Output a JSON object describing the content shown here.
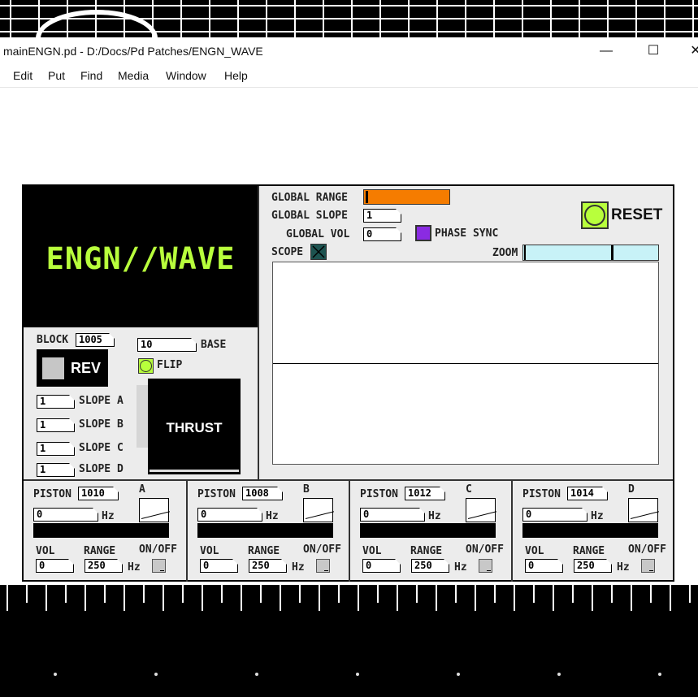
{
  "window": {
    "title": "mainENGN.pd  - D:/Docs/Pd Patches/ENGN_WAVE",
    "minimize_glyph": "—",
    "maximize_glyph": "☐",
    "close_glyph": "✕"
  },
  "menubar": {
    "items": [
      {
        "label": "Edit"
      },
      {
        "label": "Put"
      },
      {
        "label": "Find"
      },
      {
        "label": "Media"
      },
      {
        "label": "Window"
      },
      {
        "label": "Help"
      }
    ]
  },
  "patch": {
    "logo": "ENGN//WAVE",
    "global": {
      "range_label": "GLOBAL RANGE",
      "slope_label": "GLOBAL SLOPE",
      "slope_value": "1",
      "vol_label": "GLOBAL VOL",
      "vol_value": "0",
      "phase_sync_label": "PHASE SYNC",
      "scope_label": "SCOPE",
      "zoom_label": "ZOOM",
      "reset_label": "RESET"
    },
    "block": {
      "label": "BLOCK",
      "value": "1005",
      "base_value": "10",
      "base_label": "BASE",
      "rev_label": "REV",
      "flip_label": "FLIP",
      "thrust_label": "THRUST"
    },
    "slopes": [
      {
        "value": "1",
        "label": "SLOPE A"
      },
      {
        "value": "1",
        "label": "SLOPE B"
      },
      {
        "value": "1",
        "label": "SLOPE C"
      },
      {
        "value": "1",
        "label": "SLOPE D"
      }
    ],
    "pistons": [
      {
        "label": "PISTON",
        "id": "1010",
        "letter": "A",
        "hz_value": "0",
        "hz_unit": "Hz",
        "vol_label": "VOL",
        "vol_value": "0",
        "range_label": "RANGE",
        "range_value": "250",
        "range_unit": "Hz",
        "onoff_label": "ON/OFF"
      },
      {
        "label": "PISTON",
        "id": "1008",
        "letter": "B",
        "hz_value": "0",
        "hz_unit": "Hz",
        "vol_label": "VOL",
        "vol_value": "0",
        "range_label": "RANGE",
        "range_value": "250",
        "range_unit": "Hz",
        "onoff_label": "ON/OFF"
      },
      {
        "label": "PISTON",
        "id": "1012",
        "letter": "C",
        "hz_value": "0",
        "hz_unit": "Hz",
        "vol_label": "VOL",
        "vol_value": "0",
        "range_label": "RANGE",
        "range_value": "250",
        "range_unit": "Hz",
        "onoff_label": "ON/OFF"
      },
      {
        "label": "PISTON",
        "id": "1014",
        "letter": "D",
        "hz_value": "0",
        "hz_unit": "Hz",
        "vol_label": "VOL",
        "vol_value": "0",
        "range_label": "RANGE",
        "range_value": "250",
        "range_unit": "Hz",
        "onoff_label": "ON/OFF"
      }
    ],
    "colors": {
      "logo_text": "#b8ff3c",
      "range_slider": "#f57c00",
      "phase_sync_toggle": "#8a2be2",
      "reset_bang": "#b8ff3c",
      "zoom_slider": "#c8f2f7",
      "scope_toggle": "#1d5350"
    }
  }
}
